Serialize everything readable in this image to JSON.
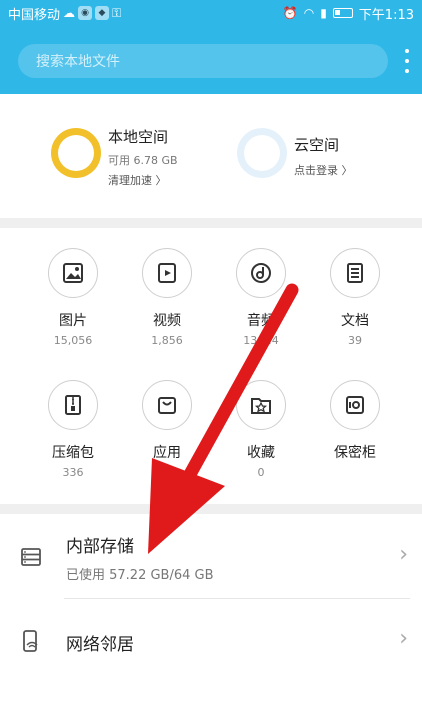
{
  "status_bar": {
    "carrier": "中国移动",
    "time": "下午1:13",
    "icons": [
      "cloud-icon",
      "app-icon",
      "app-icon",
      "key-icon",
      "alarm-icon",
      "wifi-icon",
      "signal-icon",
      "battery-icon"
    ]
  },
  "header": {
    "search_placeholder": "搜索本地文件",
    "accent_color": "#2fb7e8"
  },
  "storage": {
    "local": {
      "title": "本地空间",
      "available": "可用 6.78 GB",
      "action": "清理加速 〉",
      "ring_color": "#f1c02a"
    },
    "cloud": {
      "title": "云空间",
      "action": "点击登录 〉"
    }
  },
  "categories": [
    {
      "label": "图片",
      "count": "15,056",
      "icon": "image-icon"
    },
    {
      "label": "视频",
      "count": "1,856",
      "icon": "video-icon"
    },
    {
      "label": "音频",
      "count": "13,…4",
      "icon": "music-icon"
    },
    {
      "label": "文档",
      "count": "39",
      "icon": "document-icon"
    },
    {
      "label": "压缩包",
      "count": "336",
      "icon": "zip-icon"
    },
    {
      "label": "应用",
      "count": "",
      "icon": "app-bag-icon"
    },
    {
      "label": "收藏",
      "count": "0",
      "icon": "star-folder-icon"
    },
    {
      "label": "保密柜",
      "count": "",
      "icon": "safe-icon"
    }
  ],
  "rows": [
    {
      "title": "内部存储",
      "sub": "已使用 57.22 GB/64 GB",
      "icon": "storage-icon"
    },
    {
      "title": "网络邻居",
      "sub": "",
      "icon": "network-device-icon"
    }
  ],
  "annotation": {
    "arrow_color": "#e0191a"
  }
}
